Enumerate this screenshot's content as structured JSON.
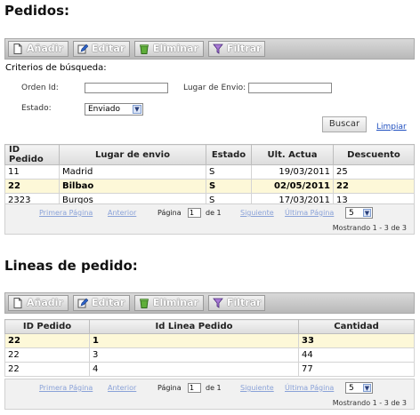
{
  "pedidos": {
    "title": "Pedidos:",
    "toolbar": {
      "add": "Añadir",
      "edit": "Editar",
      "delete": "Eliminar",
      "filter": "Filtrar"
    },
    "criteria": {
      "heading": "Criterios de búsqueda:",
      "order_id_label": "Orden Id:",
      "order_id_value": "",
      "shipping_place_label": "Lugar de Envio:",
      "shipping_place_value": "",
      "status_label": "Estado:",
      "status_value": "Enviado",
      "search_button": "Buscar",
      "clear_link": "Limpiar"
    },
    "columns": [
      "ID Pedido",
      "Lugar de envio",
      "Estado",
      "Ult. Actua",
      "Descuento"
    ],
    "rows": [
      [
        "11",
        "Madrid",
        "S",
        "19/03/2011",
        "25"
      ],
      [
        "22",
        "Bilbao",
        "S",
        "02/05/2011",
        "22"
      ],
      [
        "2323",
        "Burgos",
        "S",
        "17/03/2011",
        "13"
      ]
    ],
    "pager": {
      "first": "Primera Página",
      "prev": "Anterior",
      "page_label": "Página",
      "page_value": "1",
      "of": "de 1",
      "next": "Siguiente",
      "last": "Última Página",
      "size": "5",
      "showing": "Mostrando 1 - 3 de 3"
    }
  },
  "lineas": {
    "title": "Lineas de pedido:",
    "toolbar": {
      "add": "Añadir",
      "edit": "Editar",
      "delete": "Eliminar",
      "filter": "Filtrar"
    },
    "columns": [
      "ID Pedido",
      "Id Linea Pedido",
      "Cantidad"
    ],
    "rows": [
      [
        "22",
        "1",
        "33"
      ],
      [
        "22",
        "3",
        "44"
      ],
      [
        "22",
        "4",
        "77"
      ]
    ],
    "pager": {
      "first": "Primera Página",
      "prev": "Anterior",
      "page_label": "Página",
      "page_value": "1",
      "of": "de 1",
      "next": "Siguiente",
      "last": "Última Página",
      "size": "5",
      "showing": "Mostrando 1 - 3 de 3"
    }
  },
  "icons": {
    "add": "document-icon",
    "edit": "pencil-edit-icon",
    "delete": "trash-icon",
    "filter": "funnel-icon"
  },
  "colors": {
    "selected_row": "#fdf8d8",
    "link": "#1f4fbf",
    "toolbar": "#c7c7c7"
  }
}
